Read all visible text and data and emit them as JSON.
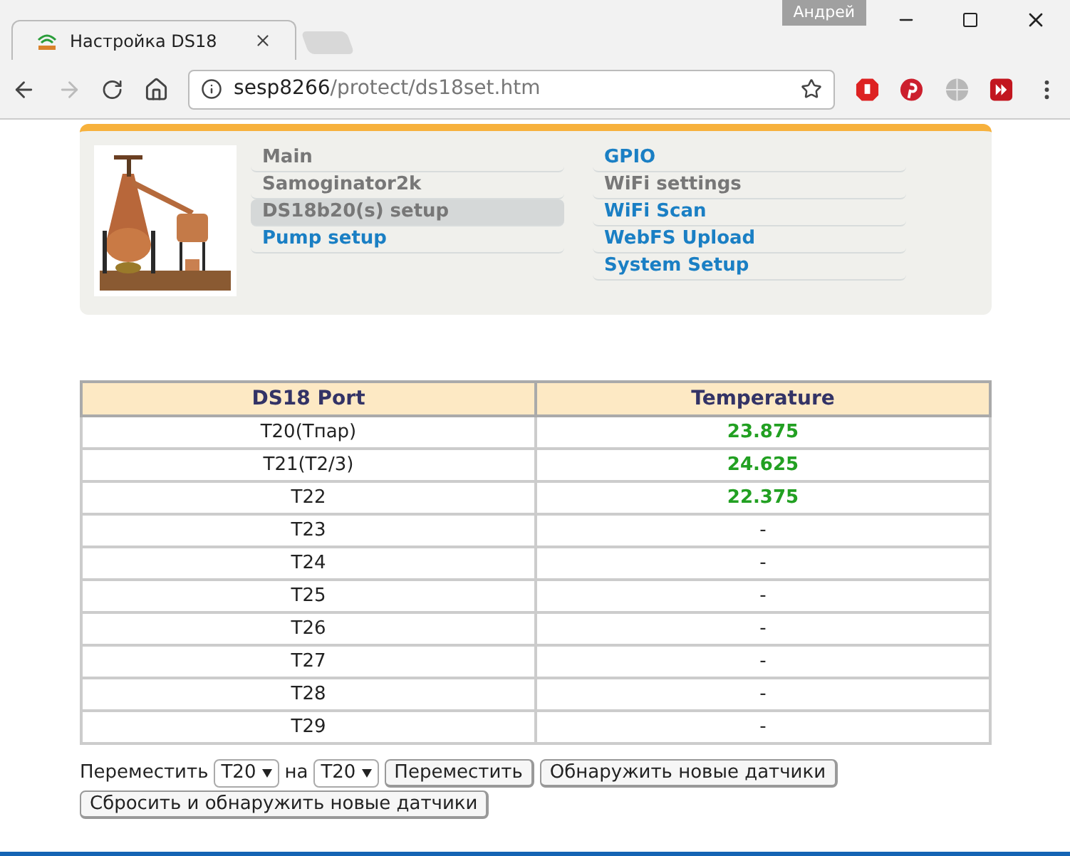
{
  "window": {
    "user": "Андрей"
  },
  "tabs": [
    {
      "title": "Настройка DS18",
      "selected": true
    }
  ],
  "address_bar": {
    "host": "sesp8266",
    "path": "/protect/ds18set.htm"
  },
  "menu": {
    "columns": [
      {
        "items": [
          {
            "label": "Main",
            "visited": true,
            "selected": false
          },
          {
            "label": "Samoginator2k",
            "visited": true,
            "selected": false
          },
          {
            "label": "DS18b20(s) setup",
            "visited": true,
            "selected": true
          },
          {
            "label": "Pump setup",
            "visited": false,
            "selected": false
          }
        ]
      },
      {
        "items": [
          {
            "label": "GPIO",
            "visited": false,
            "selected": false
          },
          {
            "label": "WiFi settings",
            "visited": true,
            "selected": false
          },
          {
            "label": "WiFi Scan",
            "visited": false,
            "selected": false
          },
          {
            "label": "WebFS Upload",
            "visited": false,
            "selected": false
          },
          {
            "label": "System Setup",
            "visited": false,
            "selected": false
          }
        ]
      }
    ]
  },
  "table": {
    "columns": [
      "DS18 Port",
      "Temperature"
    ],
    "rows": [
      {
        "port": "T20(Тпар)",
        "temperature": "23.875",
        "kind": "reading"
      },
      {
        "port": "T21(T2/3)",
        "temperature": "24.625",
        "kind": "reading"
      },
      {
        "port": "T22",
        "temperature": "22.375",
        "kind": "reading"
      },
      {
        "port": "T23",
        "temperature": "-",
        "kind": "empty"
      },
      {
        "port": "T24",
        "temperature": "-",
        "kind": "empty"
      },
      {
        "port": "T25",
        "temperature": "-",
        "kind": "empty"
      },
      {
        "port": "T26",
        "temperature": "-",
        "kind": "empty"
      },
      {
        "port": "T27",
        "temperature": "-",
        "kind": "empty"
      },
      {
        "port": "T28",
        "temperature": "-",
        "kind": "empty"
      },
      {
        "port": "T29",
        "temperature": "-",
        "kind": "empty"
      }
    ]
  },
  "controls": {
    "move_label": "Переместить",
    "from": "T20",
    "to_label": "на",
    "to": "T20",
    "buttons": [
      "Переместить",
      "Обнаружить новые датчики",
      "Сбросить и обнаружить новые датчики"
    ]
  }
}
